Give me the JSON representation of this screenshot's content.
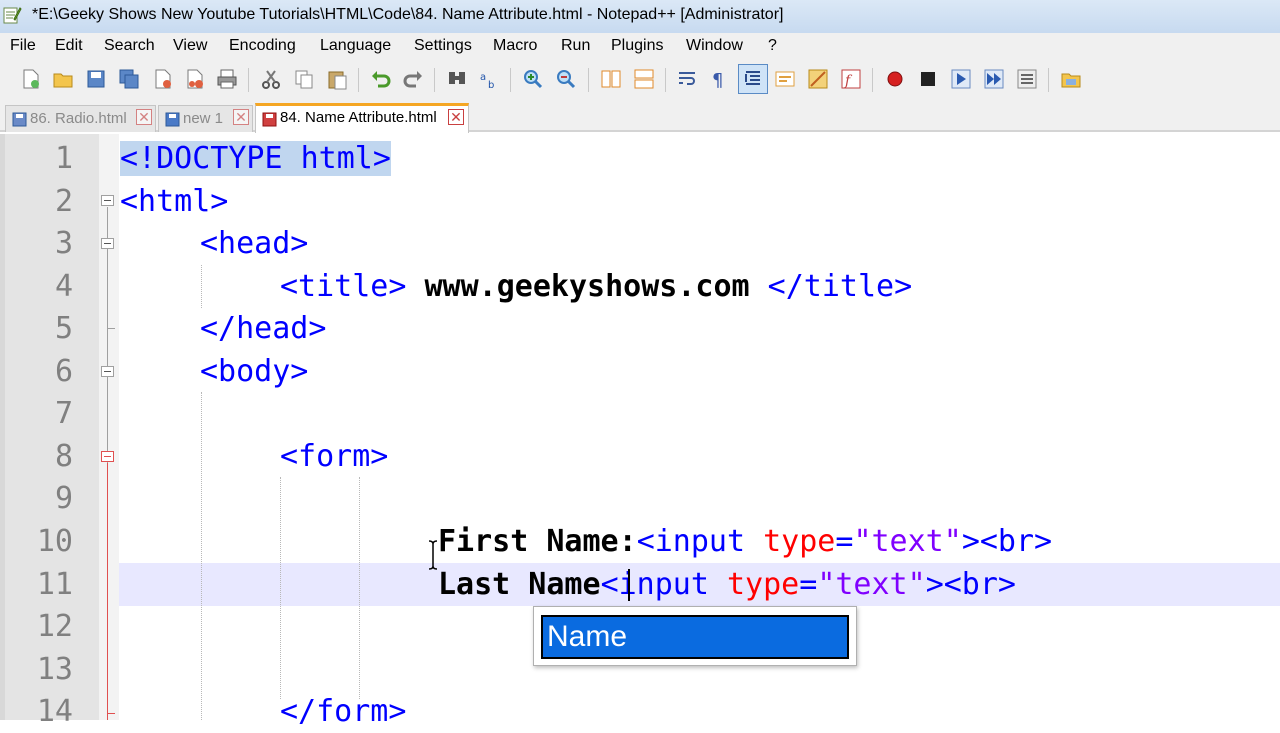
{
  "window": {
    "title": "*E:\\Geeky Shows New Youtube Tutorials\\HTML\\Code\\84. Name Attribute.html - Notepad++ [Administrator]"
  },
  "menu": [
    "File",
    "Edit",
    "Search",
    "View",
    "Encoding",
    "Language",
    "Settings",
    "Macro",
    "Run",
    "Plugins",
    "Window",
    "?"
  ],
  "tabs": [
    {
      "label": "86. Radio.html",
      "active": false
    },
    {
      "label": "new 1",
      "active": false
    },
    {
      "label": "84. Name Attribute.html",
      "active": true
    }
  ],
  "editor": {
    "line_numbers": [
      "1",
      "2",
      "3",
      "4",
      "5",
      "6",
      "7",
      "8",
      "9",
      "10",
      "11",
      "12",
      "13",
      "14"
    ],
    "lines": {
      "l1_doctype": "<!DOCTYPE html>",
      "l2_html": "<html>",
      "l3_head": "<head>",
      "l4_title_open": "<title>",
      "l4_title_text": " www.geekyshows.com ",
      "l4_title_close": "</title>",
      "l5_head_close": "</head>",
      "l6_body": "<body>",
      "l8_form": "<form>",
      "l10_text": "First Name:",
      "l10_input_open": "<input ",
      "l10_attr": "type",
      "l10_eq": "=",
      "l10_val": "\"text\"",
      "l10_close": "><br>",
      "l11_text": "Last Name",
      "l11_input_open": "<input ",
      "l11_attr": "type",
      "l11_eq": "=",
      "l11_val": "\"text\"",
      "l11_close": "><br>",
      "l14_form_close": "</form>"
    },
    "current_line": "11"
  },
  "autocomplete": {
    "items": [
      "Name"
    ],
    "selected": "Name"
  },
  "colors": {
    "tag": "#0000ff",
    "attribute": "#ff0000",
    "string": "#8000ff",
    "selection": "#0a6be0"
  }
}
